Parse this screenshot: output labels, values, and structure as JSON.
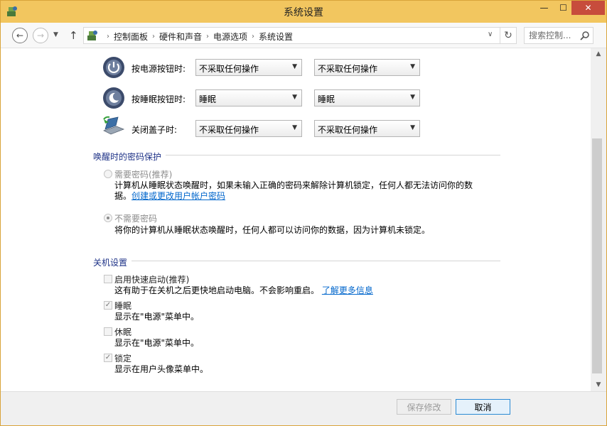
{
  "window": {
    "title": "系统设置",
    "min_glyph": "—",
    "max_glyph": "☐",
    "close_glyph": "✕"
  },
  "nav": {
    "back_glyph": "←",
    "forward_glyph": "→",
    "recent_glyph": "▼",
    "up_glyph": "↑",
    "crumbs": [
      "控制面板",
      "硬件和声音",
      "电源选项",
      "系统设置"
    ],
    "crumb_sep": "›",
    "dropdown_glyph": "∨",
    "refresh_glyph": "↻",
    "search_placeholder": "搜索控制...",
    "icons": {
      "app": "control-panel-icon",
      "search": "magnifier-icon"
    }
  },
  "power_rows": [
    {
      "label": "按电源按钮时:",
      "battery": "不采取任何操作",
      "plugged": "不采取任何操作",
      "icon": "power-button-icon"
    },
    {
      "label": "按睡眠按钮时:",
      "battery": "睡眠",
      "plugged": "睡眠",
      "icon": "sleep-button-icon"
    },
    {
      "label": "关闭盖子时:",
      "battery": "不采取任何操作",
      "plugged": "不采取任何操作",
      "icon": "laptop-lid-icon"
    }
  ],
  "select_arrow": "▼",
  "password_section": {
    "title": "唤醒时的密码保护",
    "require": {
      "label": "需要密码(推荐)",
      "desc_line1": "计算机从睡眠状态唤醒时，如果未输入正确的密码来解除计算机锁定，任何人都无法访问你的数",
      "desc_line2_prefix": "据。",
      "link": "创建或更改用户帐户密码"
    },
    "no_require": {
      "label": "不需要密码",
      "desc": "将你的计算机从睡眠状态唤醒时，任何人都可以访问你的数据，因为计算机未锁定。"
    }
  },
  "shutdown_section": {
    "title": "关机设置",
    "items": [
      {
        "label": "启用快速启动(推荐)",
        "desc": "这有助于在关机之后更快地启动电脑。不会影响重启。",
        "link": "了解更多信息",
        "checked": false,
        "enabled": false
      },
      {
        "label": "睡眠",
        "desc": "显示在\"电源\"菜单中。",
        "checked": true,
        "enabled": false
      },
      {
        "label": "休眠",
        "desc": "显示在\"电源\"菜单中。",
        "checked": false,
        "enabled": false
      },
      {
        "label": "锁定",
        "desc": "显示在用户头像菜单中。",
        "checked": true,
        "enabled": false
      }
    ],
    "check_glyph": "✓"
  },
  "scrollbar": {
    "up_glyph": "▲",
    "down_glyph": "▼"
  },
  "footer": {
    "save_label": "保存修改",
    "cancel_label": "取消"
  }
}
